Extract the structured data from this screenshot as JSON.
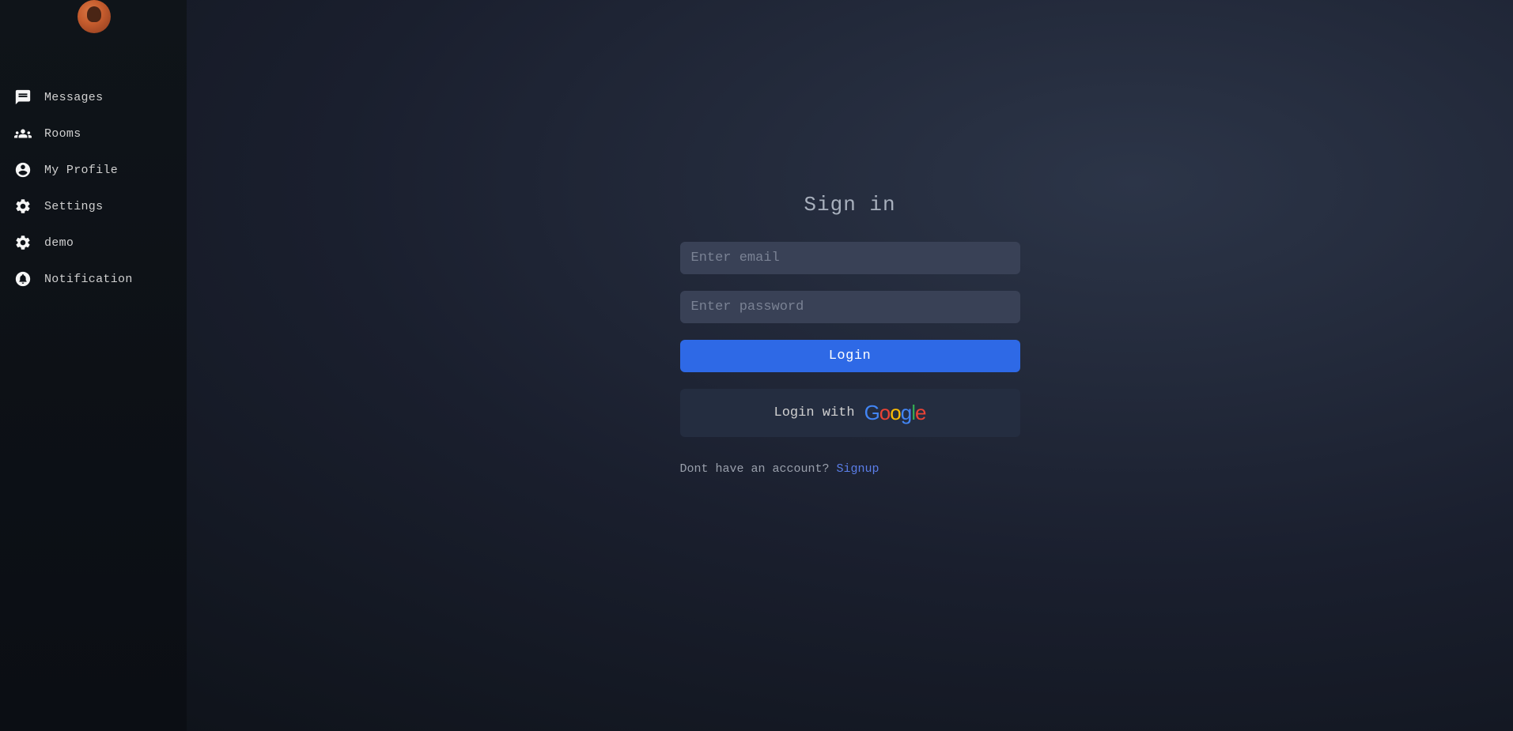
{
  "sidebar": {
    "items": [
      {
        "label": "Messages",
        "icon": "message-icon"
      },
      {
        "label": "Rooms",
        "icon": "group-icon"
      },
      {
        "label": "My Profile",
        "icon": "account-icon"
      },
      {
        "label": "Settings",
        "icon": "settings-icon"
      },
      {
        "label": "demo",
        "icon": "settings-icon"
      },
      {
        "label": "Notification",
        "icon": "bell-icon"
      }
    ]
  },
  "login": {
    "title": "Sign in",
    "email_placeholder": "Enter email",
    "password_placeholder": "Enter password",
    "login_button": "Login",
    "google_button_prefix": "Login with ",
    "no_account_text": "Dont have an account?",
    "signup_link": "Signup"
  }
}
